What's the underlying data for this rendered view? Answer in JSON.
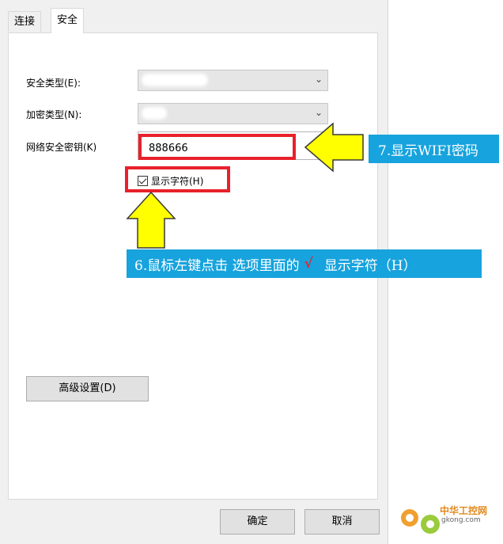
{
  "tabs": [
    {
      "label": "连接"
    },
    {
      "label": "安全"
    }
  ],
  "security": {
    "type_label": "安全类型(E):",
    "encryption_label": "加密类型(N):",
    "key_label": "网络安全密钥(K)",
    "key_value": "888666",
    "show_chars_label": "显示字符(H)",
    "show_chars_checked": true
  },
  "buttons": {
    "advanced": "高级设置(D)",
    "ok": "确定",
    "cancel": "取消"
  },
  "callouts": {
    "step7": "7.显示WIFI密码",
    "step6_prefix": "6.鼠标左键点击 选项里面的",
    "step6_mark": "√",
    "step6_suffix": "显示字符（H）"
  },
  "watermark": {
    "title": "中华工控网",
    "url": "gkong.com"
  },
  "colors": {
    "highlight_red": "#e8212b",
    "callout_blue": "#17a3dd",
    "arrow_yellow": "#ffff00"
  }
}
